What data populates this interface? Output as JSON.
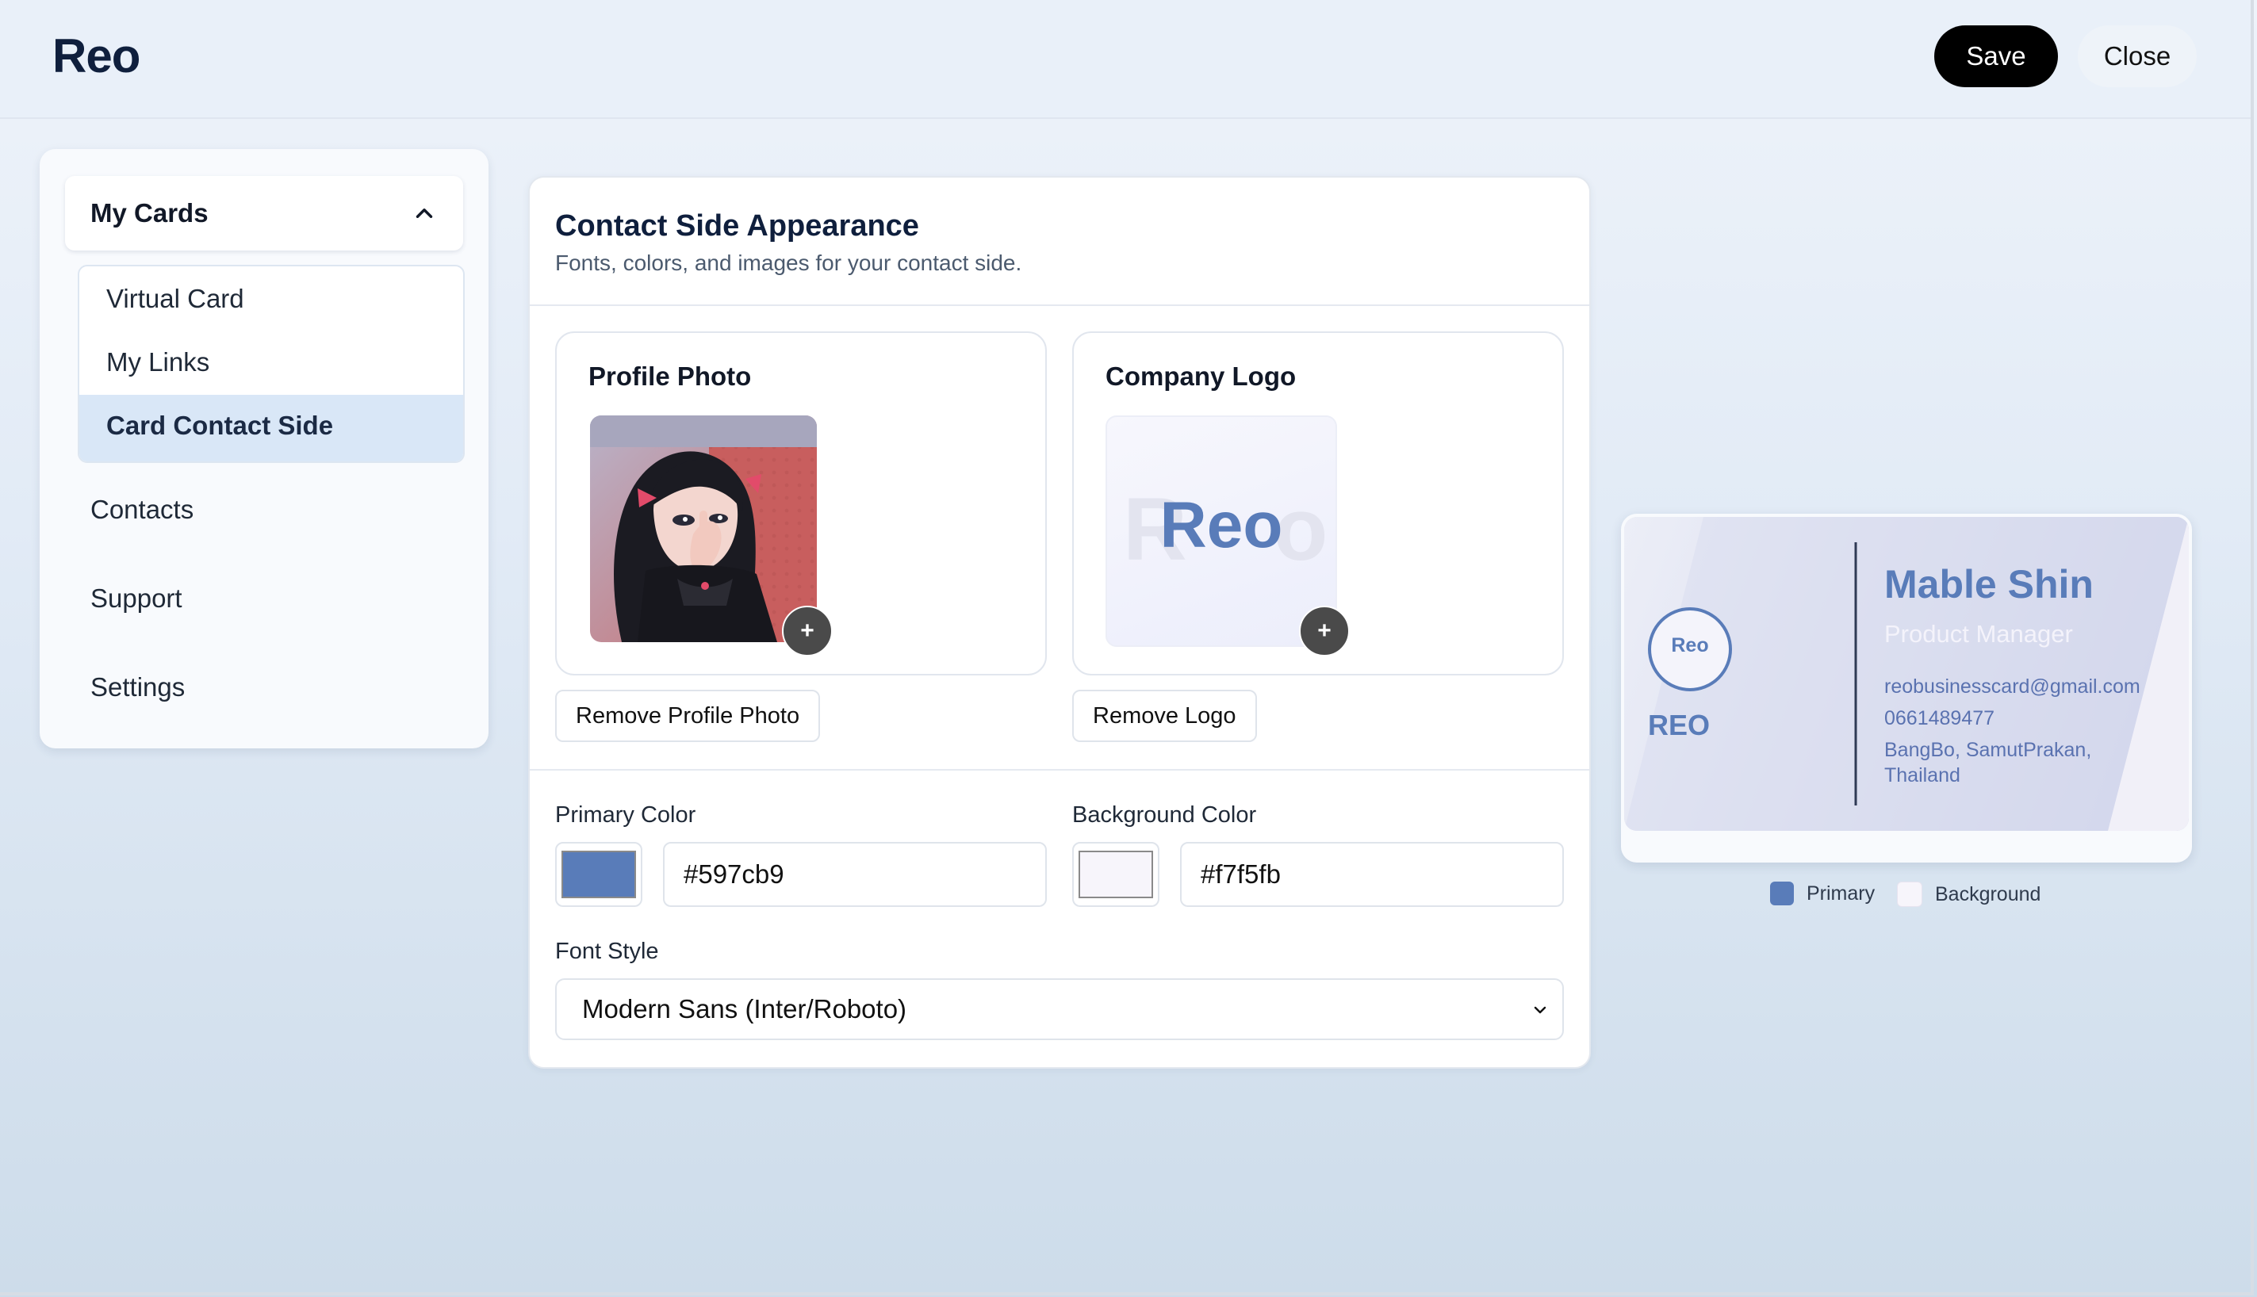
{
  "header": {
    "brand": "Reo",
    "save_label": "Save",
    "close_label": "Close"
  },
  "sidebar": {
    "group": {
      "label": "My Cards",
      "expanded": true
    },
    "sub_items": [
      {
        "label": "Virtual Card",
        "active": false
      },
      {
        "label": "My Links",
        "active": false
      },
      {
        "label": "Card Contact Side",
        "active": true
      }
    ],
    "items": [
      {
        "label": "Contacts"
      },
      {
        "label": "Support"
      },
      {
        "label": "Settings"
      }
    ]
  },
  "panel": {
    "title": "Contact Side Appearance",
    "subtitle": "Fonts, colors, and images for your contact side.",
    "profile_photo": {
      "title": "Profile Photo",
      "remove_label": "Remove Profile Photo",
      "add_icon": "+"
    },
    "company_logo": {
      "title": "Company Logo",
      "logo_text": "Reo",
      "remove_label": "Remove Logo",
      "add_icon": "+"
    },
    "primary_color": {
      "label": "Primary Color",
      "value": "#597cb9"
    },
    "background_color": {
      "label": "Background Color",
      "value": "#f7f5fb"
    },
    "font_style": {
      "label": "Font Style",
      "value": "Modern Sans (Inter/Roboto)"
    }
  },
  "preview": {
    "logo_text": "Reo",
    "company": "REO",
    "name": "Mable Shin",
    "title": "Product Manager",
    "email": "reobusinesscard@gmail.com",
    "phone": "0661489477",
    "address_line1": "BangBo, SamutPrakan,",
    "address_line2": "Thailand",
    "legend": {
      "primary": "Primary",
      "background": "Background"
    }
  },
  "colors": {
    "primary": "#597cb9",
    "background": "#f7f5fb",
    "brand_text": "#0f1f3d",
    "active_item": "#d9e7f7"
  },
  "icons": {
    "group_toggle": "chevron-up-icon",
    "select_toggle": "chevron-down-icon",
    "add": "plus-icon"
  }
}
